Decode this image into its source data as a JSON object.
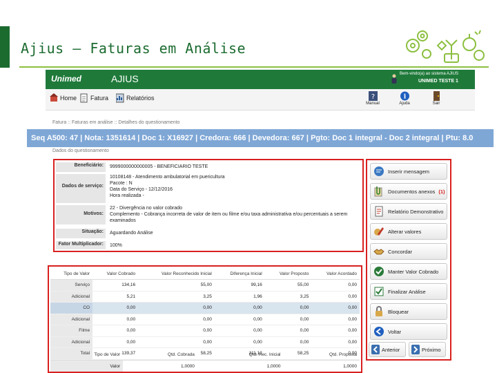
{
  "slide": {
    "title": "Ajius – Faturas em Análise"
  },
  "app": {
    "logo": "Unimed",
    "name": "AJIUS",
    "user_welcome": "Bem-vindo(a) ao sistema AJIUS",
    "user_name": "UNIMED TESTE 1"
  },
  "nav": {
    "home": "Home",
    "fatura": "Fatura",
    "relatorios": "Relatórios",
    "manual": "Manual",
    "ajuda": "Ajuda",
    "sair": "Sair"
  },
  "breadcrumb": "Fatura :: Faturas em análise :: Detalhes do questionamento",
  "info_bar": "Seq A500: 47 | Nota: 1351614 | Doc 1: X16927 | Credora: 666 | Devedora: 667 | Pgto: Doc 1 integral - Doc 2 integral | Ptu: 8.0",
  "section_label": "Dados do questionamento",
  "details": {
    "beneficiario_label": "Beneficiário:",
    "beneficiario_value": "9999000000000005 - BENEFICIARIO TESTE",
    "servico_label": "Dados de serviço:",
    "servico_lines": [
      "10108148 - Atendimento ambulatorial em puericultura",
      "Pacote : N",
      "Data do Serviço - 12/12/2016",
      "Hora realizada -"
    ],
    "motivos_label": "Motivos:",
    "motivos_lines": [
      "22 - Divergência no valor cobrado",
      "Complemento - Cobrança incorreta de valor de item ou filme e/ou taxa administrativa e/ou percentuais a serem examinados"
    ],
    "situacao_label": "Situação:",
    "situacao_value": "Aguardando Análise",
    "fator_label": "Fator Multiplicador:",
    "fator_value": "100%"
  },
  "actions": {
    "inserir": "Inserir mensagem",
    "documentos": "Documentos anexos",
    "documentos_flag": "(1)",
    "relatorio": "Relatório Demonstrativo",
    "alterar": "Alterar valores",
    "concordar": "Concordar",
    "manter": "Manter Valor Cobrado",
    "finalizar": "Finalizar Análise",
    "bloquear": "Bloquear",
    "voltar": "Voltar",
    "anterior": "Anterior",
    "proximo": "Próximo"
  },
  "values_table": {
    "headers": [
      "Tipo de Valor",
      "Valor Cobrado",
      "Valor Reconhecido Inicial",
      "Diferença Inicial",
      "Valor Proposto",
      "Valor Acordado"
    ],
    "rows": [
      [
        "Serviço",
        "134,16",
        "55,00",
        "99,16",
        "55,00",
        "0,00"
      ],
      [
        "Adicional",
        "5,21",
        "3,25",
        "1,96",
        "3,25",
        "0,00"
      ],
      [
        "CO",
        "0,00",
        "0,00",
        "0,00",
        "0,00",
        "0,00"
      ],
      [
        "Adicional",
        "0,00",
        "0,00",
        "0,00",
        "0,00",
        "0,00"
      ],
      [
        "Filme",
        "0,00",
        "0,00",
        "0,00",
        "0,00",
        "0,00"
      ],
      [
        "Adicional",
        "0,00",
        "0,00",
        "0,00",
        "0,00",
        "0,00"
      ],
      [
        "Total",
        "139,37",
        "58,25",
        "111,12",
        "58,25",
        "0,00"
      ]
    ],
    "highlight_row": 2
  },
  "multiplier_table": {
    "headers": [
      "Tipo de Valor",
      "Qtd. Cobrada",
      "Qtd. Rec. Inicial",
      "Qtd. Proposta"
    ],
    "rows": [
      [
        "Valor",
        "1,0000",
        "1,0000",
        "1,0000"
      ]
    ]
  },
  "colors": {
    "brand_green": "#1f7a3a",
    "info_bar": "#7fa7d6",
    "highlight_border": "#d8201f",
    "title_green": "#1b6b2f"
  }
}
